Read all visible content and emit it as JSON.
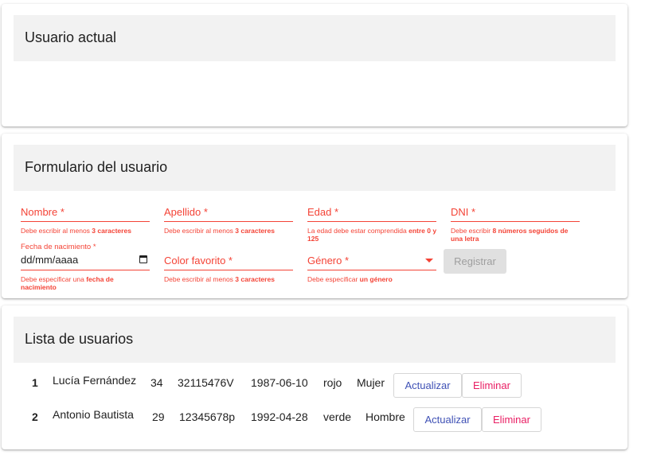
{
  "current_user": {
    "title": "Usuario actual"
  },
  "form": {
    "title": "Formulario del usuario",
    "nombre_label": "Nombre *",
    "nombre_error_pre": "Debe escribir al menos ",
    "nombre_error_bold": "3 caracteres",
    "apellido_label": "Apellido *",
    "apellido_error_pre": "Debe escribir al menos ",
    "apellido_error_bold": "3 caracteres",
    "edad_label": "Edad *",
    "edad_error_pre": "La edad debe estar comprendida ",
    "edad_error_bold": "entre 0 y 125",
    "dni_label": "DNI *",
    "dni_error_pre": "Debe escribir ",
    "dni_error_bold": "8 números seguidos de una letra",
    "fecha_label": "Fecha de nacimiento *",
    "fecha_placeholder": "dd/mm/aaaa",
    "fecha_error_pre": "Debe especificar una ",
    "fecha_error_bold": "fecha de nacimiento",
    "color_label": "Color favorito *",
    "color_error_pre": "Debe escribir al menos ",
    "color_error_bold": "3 caracteres",
    "genero_label": "Género *",
    "genero_error_pre": "Debe especificar ",
    "genero_error_bold": "un género",
    "register_label": "Registrar"
  },
  "users_list": {
    "title": "Lista de usuarios",
    "update_label": "Actualizar",
    "delete_label": "Eliminar",
    "rows": [
      {
        "index": "1",
        "name": "Lucía Fernández",
        "age": "34",
        "dni": "32115476V",
        "birthdate": "1987-06-10",
        "color": "rojo",
        "gender": "Mujer"
      },
      {
        "index": "2",
        "name": "Antonio Bautista",
        "age": "29",
        "dni": "12345678p",
        "birthdate": "1992-04-28",
        "color": "verde",
        "gender": "Hombre"
      }
    ]
  },
  "colors": {
    "error": "#f44336",
    "update": "#3f51b5",
    "delete": "#e91e63",
    "header_bg": "#f2f2f2"
  }
}
